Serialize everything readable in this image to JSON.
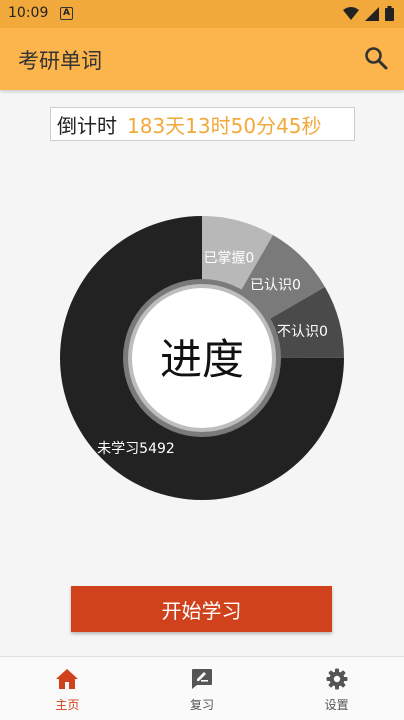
{
  "status": {
    "time": "10:09",
    "notif_letter": "A"
  },
  "appbar": {
    "title": "考研单词"
  },
  "countdown": {
    "label": "倒计时",
    "value": "183天13时50分45秒"
  },
  "chart_data": {
    "type": "pie",
    "center_label": "进度",
    "labels": [
      "已掌握0",
      "已认识0",
      "不认识0",
      "未学习5492"
    ],
    "categories": [
      "已掌握",
      "已认识",
      "不认识",
      "未学习"
    ],
    "values": [
      0,
      0,
      0,
      5492
    ],
    "colors": [
      "#b8b8b8",
      "#7a7a7a",
      "#4a4a4a",
      "#222222"
    ]
  },
  "start_button": {
    "label": "开始学习"
  },
  "nav": [
    {
      "label": "主页",
      "icon": "home-icon",
      "active": true
    },
    {
      "label": "复习",
      "icon": "review-icon",
      "active": false
    },
    {
      "label": "设置",
      "icon": "settings-icon",
      "active": false
    }
  ],
  "colors": {
    "accent": "#fbb54c",
    "primary_button": "#d0421b",
    "countdown_text": "#f2a93b"
  }
}
